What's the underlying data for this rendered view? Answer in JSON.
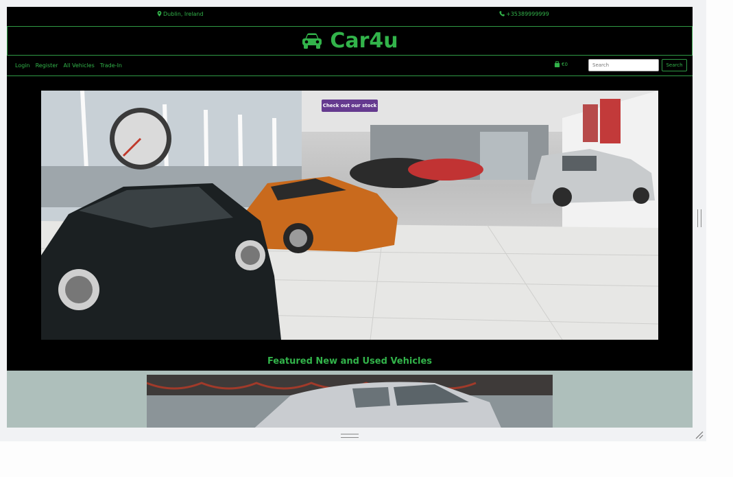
{
  "topbar": {
    "location": "Dublin, Ireland",
    "phone": "+35389999999"
  },
  "brand": {
    "name": "Car4u",
    "icon": "car-icon"
  },
  "nav": {
    "links": [
      "Login",
      "Register",
      "All Vehicles",
      "Trade-In"
    ],
    "cart_total": "€0",
    "search_placeholder": "Search",
    "search_button": "Search"
  },
  "hero": {
    "cta_label": "Check out our stock"
  },
  "featured": {
    "heading": "Featured New and Used Vehicles"
  },
  "colors": {
    "accent_green": "#32b34a",
    "cta_purple": "#653a8f",
    "featured_band": "#aebfbb",
    "page_background": "#000000"
  }
}
